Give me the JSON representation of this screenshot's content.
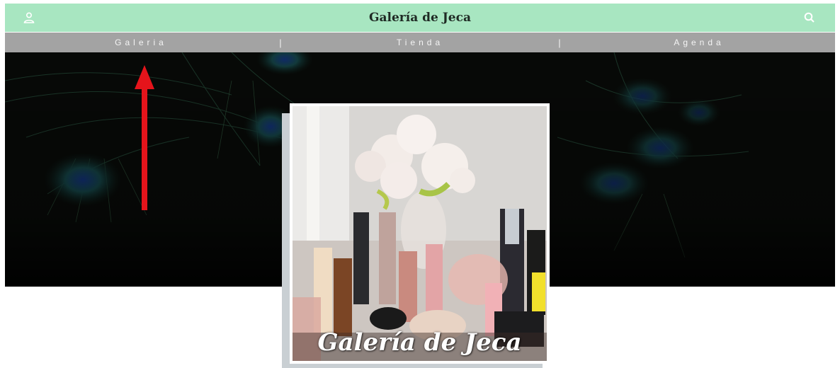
{
  "header": {
    "title": "Galería de Jeca",
    "account_icon": "user-icon",
    "search_icon": "search-icon",
    "background": "#a8e6c1"
  },
  "nav": {
    "items": [
      {
        "label": "Galeria"
      },
      {
        "label": "Tienda"
      },
      {
        "label": "Agenda"
      }
    ],
    "separator": "|",
    "background": "#a3a3a3"
  },
  "hero": {
    "image": "peacock-feathers-image",
    "annotation": "red-arrow-pointing-up"
  },
  "featured": {
    "image": "makeup-and-peonies-photo",
    "caption": "Galería de Jeca"
  }
}
